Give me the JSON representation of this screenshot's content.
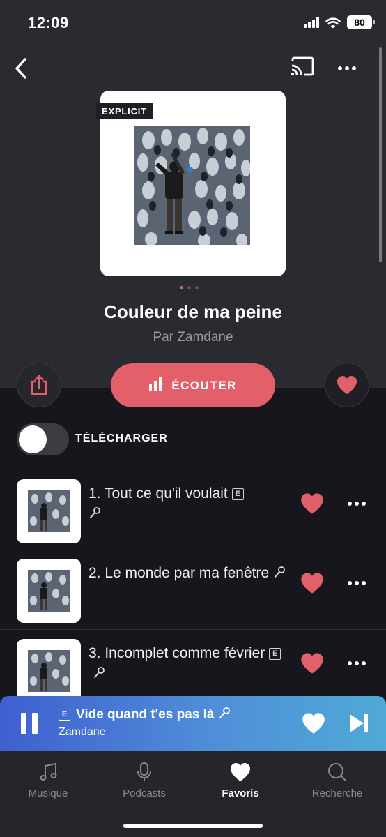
{
  "status_bar": {
    "time": "12:09",
    "battery": "80"
  },
  "header": {
    "back_icon": "chevron-left-icon",
    "cast_icon": "cast-icon",
    "more_icon": "more-horizontal-icon"
  },
  "album": {
    "explicit_label": "EXPLICIT",
    "title": "Couleur de ma peine",
    "artist_line": "Par Zamdane",
    "cover_pages": 3,
    "cover_page_active": 1
  },
  "actions": {
    "share_icon": "share-icon",
    "listen_label": "ÉCOUTER",
    "favorite_icon": "heart-icon"
  },
  "download": {
    "label": "TÉLÉCHARGER",
    "enabled": false
  },
  "tracks": [
    {
      "title": "1. Tout ce qu'il voulait",
      "explicit_badge": "E",
      "explicit": true,
      "lyrics": true,
      "liked": true
    },
    {
      "title": "2. Le monde par ma fenêtre",
      "explicit_badge": "",
      "explicit": false,
      "lyrics": true,
      "liked": true
    },
    {
      "title": "3. Incomplet comme février",
      "explicit_badge": "E",
      "explicit": true,
      "lyrics": true,
      "liked": true
    }
  ],
  "now_playing": {
    "explicit_badge": "E",
    "title": "Vide quand t'es pas là",
    "artist": "Zamdane",
    "liked": true
  },
  "tab_bar": [
    {
      "label": "Musique",
      "icon": "music-note-icon",
      "active": false
    },
    {
      "label": "Podcasts",
      "icon": "microphone-icon",
      "active": false
    },
    {
      "label": "Favoris",
      "icon": "heart-icon",
      "active": true
    },
    {
      "label": "Recherche",
      "icon": "search-icon",
      "active": false
    }
  ],
  "colors": {
    "accent": "#e3606b",
    "background": "#17161c",
    "header_background": "#2a2a31",
    "mini_player_start": "#3f5fd0",
    "mini_player_end": "#4faad6"
  }
}
